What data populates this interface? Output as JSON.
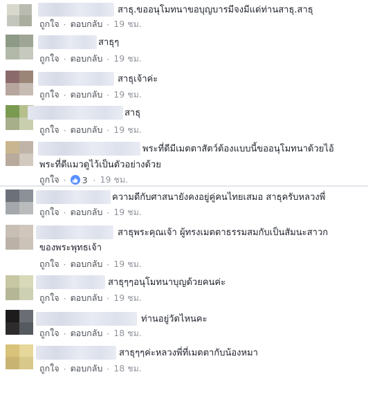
{
  "comments": [
    {
      "text_lines": [
        "สาธุ.ขออนุโมทนาขอบุญบารมีจงมีแด่ท่านสาธุ.สาธุ"
      ],
      "like_label": "ถูกใจ",
      "reply_label": "ตอบกลับ",
      "time": "19 ชม.",
      "avatar_colors": [
        "#d8d8cc",
        "#b9bbb0",
        "#c2c6bd",
        "#a9ae9f"
      ]
    },
    {
      "text_lines": [
        "สาธุๆ"
      ],
      "like_label": "ถูกใจ",
      "reply_label": "ตอบกลับ",
      "time": "19 ชม.",
      "avatar_colors": [
        "#8d9a86",
        "#9fa595",
        "#b3b9a8",
        "#c6c9bd"
      ]
    },
    {
      "text_lines": [
        "สาธุเจ้าค่ะ"
      ],
      "like_label": "ถูกใจ",
      "reply_label": "ตอบกลับ",
      "time": "19 ชม.",
      "avatar_colors": [
        "#8a6a6b",
        "#9a8577",
        "#b6a69d",
        "#c7bcb4"
      ]
    },
    {
      "text_lines": [
        "สาธุ"
      ],
      "like_label": "ถูกใจ",
      "reply_label": "ตอบกลับ",
      "time": "19 ชม.",
      "avatar_colors": [
        "#7a9a52",
        "#b5c08d",
        "#a6ae8a",
        "#c9cfae"
      ]
    },
    {
      "text_lines": [
        "พระที่ดีมีเมตตาสัตว์ต้องแบบนี้ขออนุโมทนาด้วยไอ้",
        "พระที่ดีแมวดูไว้เป็นตัวอย่างด้วย"
      ],
      "like_label": "ถูกใจ",
      "reply_label": "",
      "reaction_count": "3",
      "time": "19 ชม.",
      "avatar_colors": [
        "#c9b58f",
        "#bfb4a7",
        "#b8aa9c",
        "#d2cabf"
      ]
    },
    {
      "text_lines": [
        "ความดีกับศาสนายังคงอยู่คู่คนไทยเสมอ สาธุครับหลวงพี่"
      ],
      "like_label": "ถูกใจ",
      "reply_label": "ตอบกลับ",
      "time": "19 ชม.",
      "avatar_colors": [
        "#6c7179",
        "#8c9198",
        "#a4a7ab",
        "#b9bbbd"
      ]
    },
    {
      "text_lines": [
        "สาธุพระคุณเจ้า ผู้ทรงเมตตาธรรมสมกับเป็นสัมนะสาวก",
        "ของพระพุทธเจ้า"
      ],
      "like_label": "ถูกใจ",
      "reply_label": "ตอบกลับ",
      "time": "19 ชม.",
      "avatar_colors": [
        "#c7bfb4",
        "#d0c6bb",
        "#bcb1a6",
        "#cbc2b8"
      ]
    },
    {
      "text_lines": [
        "สาธุๆๆอนุโมทนาบุญด้วยคนค่ะ"
      ],
      "like_label": "ถูกใจ",
      "reply_label": "ตอบกลับ",
      "time": "19 ชม.",
      "avatar_colors": [
        "#c7c7a4",
        "#d7d9b8",
        "#b4b695",
        "#cdd0b3"
      ]
    },
    {
      "text_lines": [
        "ท่านอยู่วัดไหนคะ"
      ],
      "like_label": "ถูกใจ",
      "reply_label": "ตอบกลับ",
      "time": "18 ชม.",
      "avatar_colors": [
        "#1e1b1c",
        "#6a6e74",
        "#2d2b2c",
        "#555a60"
      ]
    },
    {
      "text_lines": [
        "สาธุๆๆค่ะหลวงพี่ที่เมตตากับน้องหมา"
      ],
      "like_label": "ถูกใจ",
      "reply_label": "ตอบกลับ",
      "time": "18 ชม.",
      "avatar_colors": [
        "#d9c279",
        "#e6d79a",
        "#c9b372",
        "#d8c88a"
      ]
    }
  ],
  "icons": {
    "reaction": "thumbs-up-icon"
  },
  "colors": {
    "link": "#4b4f56",
    "meta": "#90949c",
    "reaction_blue": "#5890ff",
    "text": "#1d2129"
  }
}
